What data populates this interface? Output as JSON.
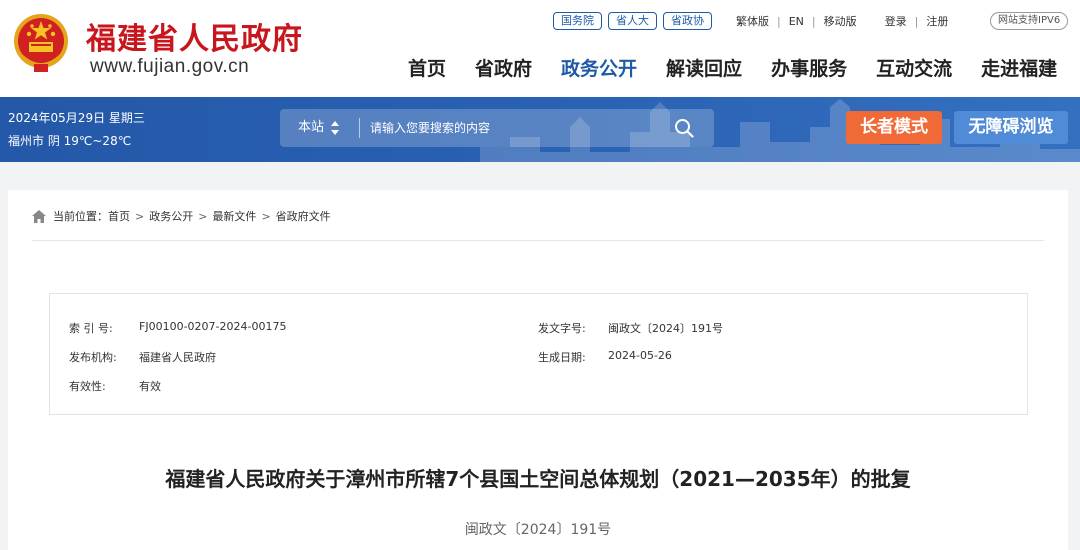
{
  "header": {
    "site_name": "福建省人民政府",
    "site_url": "www.fujian.gov.cn",
    "pills": [
      "国务院",
      "省人大",
      "省政协"
    ],
    "lang_links": [
      "繁体版",
      "EN",
      "移动版"
    ],
    "user_links": [
      "登录",
      "注册"
    ],
    "ipv6": "网站支持IPV6",
    "nav": [
      "首页",
      "省政府",
      "政务公开",
      "解读回应",
      "办事服务",
      "互动交流",
      "走进福建"
    ],
    "active_nav": "政务公开"
  },
  "banner": {
    "date": "2024年05月29日 星期三",
    "weather": "福州市 阴 19℃~28℃",
    "search_scope": "本站",
    "search_placeholder": "请输入您要搜索的内容",
    "elder_mode": "长者模式",
    "accessible": "无障碍浏览"
  },
  "breadcrumb": {
    "prefix": "当前位置：",
    "items": [
      "首页",
      "政务公开",
      "最新文件",
      "省政府文件"
    ]
  },
  "meta": {
    "index_label": "索 引 号:",
    "index_value": "FJ00100-0207-2024-00175",
    "doc_no_label": "发文字号:",
    "doc_no_value": "闽政文〔2024〕191号",
    "org_label": "发布机构:",
    "org_value": "福建省人民政府",
    "date_label": "生成日期:",
    "date_value": "2024-05-26",
    "validity_label": "有效性:",
    "validity_value": "有效"
  },
  "document": {
    "title": "福建省人民政府关于漳州市所辖7个县国土空间总体规划（2021—2035年）的批复",
    "number": "闽政文〔2024〕191号"
  },
  "colors": {
    "brand_red": "#c8161d",
    "brand_blue": "#1f5aa6",
    "elder_orange": "#ef6a36",
    "access_blue": "#4f8bd6"
  }
}
